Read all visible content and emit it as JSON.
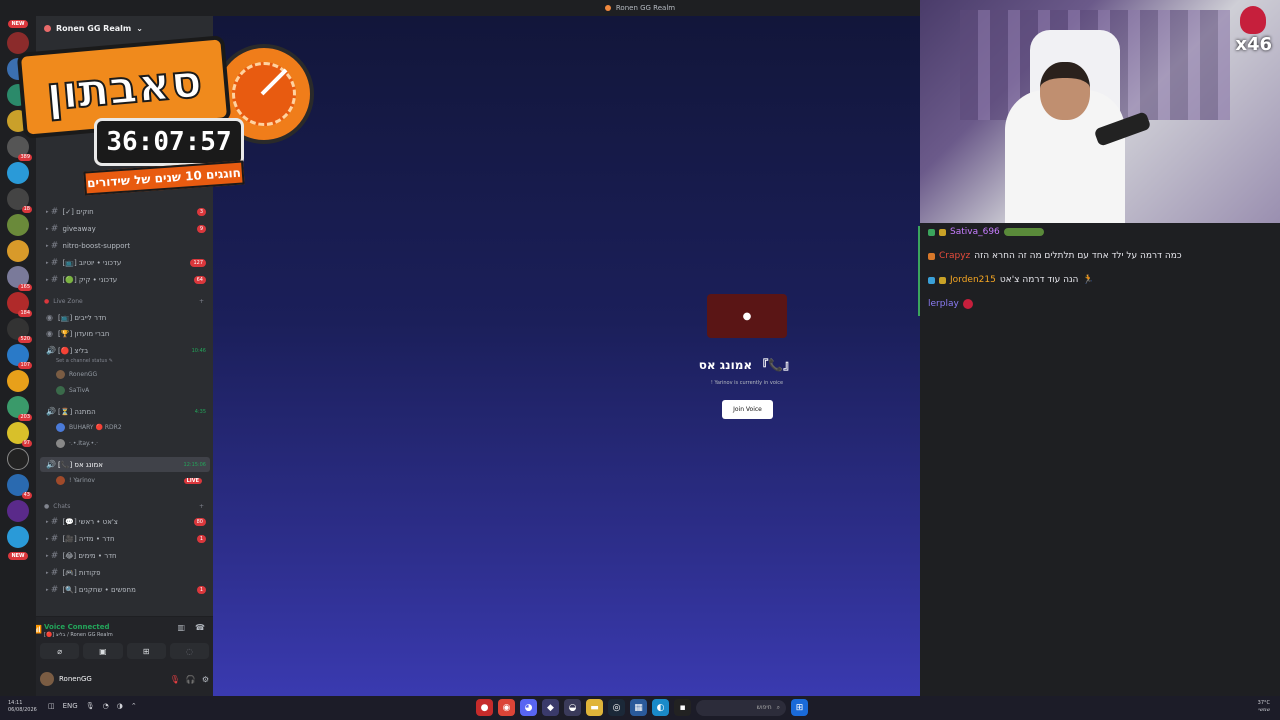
{
  "window": {
    "title": "Ronen GG Realm"
  },
  "guild": {
    "name": "Ronen GG Realm"
  },
  "rail": {
    "new_top": "NEW",
    "new_bottom": "NEW",
    "counts": [
      "389",
      "18",
      "165",
      "184",
      "520",
      "107",
      "203",
      "97",
      "43"
    ]
  },
  "channels": [
    {
      "name": "[✓] חוקים",
      "badge": "3"
    },
    {
      "name": "giveaway",
      "badge": "9"
    },
    {
      "name": "nitro-boost-support",
      "badge": ""
    },
    {
      "name": "[📺] עדכוני • יוטיוב",
      "badge": "127"
    },
    {
      "name": "[🟢] עדכוני • קיק",
      "badge": "64"
    }
  ],
  "live_zone": {
    "category": "Live Zone",
    "channels": [
      {
        "name": "[📺] חדר לייבים"
      },
      {
        "name": "[🏆] חברי מועדון"
      }
    ],
    "voice": [
      {
        "name": "[🔴] בליצ",
        "time": "10:46",
        "status": "Set a channel status ✎",
        "users": [
          "RonenGG",
          "SaTivA"
        ]
      },
      {
        "name": "[⏳] המתנה",
        "time": "4:35",
        "users": [
          "BUHARY 🔴 RDR2",
          "·.•.Itay.•.·"
        ]
      },
      {
        "name": "[📞] אמונג אס",
        "time": "12:15:06",
        "users": [
          "! Yarinov"
        ],
        "live": "LIVE"
      }
    ]
  },
  "chats": {
    "category": "Chats",
    "channels": [
      {
        "name": "[💬] צ'אט • ראשי",
        "badge": "80"
      },
      {
        "name": "[🎥] חדר • מדיה",
        "badge": "1"
      },
      {
        "name": "[😂] חדר • מימים",
        "badge": ""
      },
      {
        "name": "[🎮] פקודות",
        "badge": ""
      },
      {
        "name": "[🔍] מחפשים • שחקנים",
        "badge": "1"
      }
    ]
  },
  "voice_panel": {
    "title": "Voice Connected",
    "subtitle": "[🔴] בליצ / Ronen GG Realm"
  },
  "user": {
    "name": "RonenGG"
  },
  "main": {
    "channel_title": "אמונג אס 『📞』",
    "status": "! Yarinov is currently in voice",
    "join_label": "Join Voice"
  },
  "overlay": {
    "subathon_word": "סאבתון",
    "timer": "36:07:57",
    "banner": "חוגגים 10 שנים של שידורים",
    "gift_counter": "x46"
  },
  "chat": [
    {
      "user": "Sativa_696",
      "color": "#c77dff",
      "text": ""
    },
    {
      "user": "Crapyz",
      "color": "#e74c3c",
      "text": "כמה דרמה על ילד אחד עם תלתלים מה זה החרא הזה"
    },
    {
      "user": "Jorden215",
      "color": "#f5a623",
      "text": "הנה עוד דרמה צ'אט"
    },
    {
      "user": "lerplay",
      "color": "#8b7cf6",
      "text": ""
    }
  ],
  "taskbar": {
    "time": "14:11",
    "date": "06/08/2026",
    "lang": "ENG",
    "search_placeholder": "חיפוש",
    "weather_temp": "37°C",
    "weather_desc": "שמשי"
  },
  "colors": {
    "accent": "#5865f2",
    "online": "#23a55a",
    "danger": "#da373c"
  }
}
